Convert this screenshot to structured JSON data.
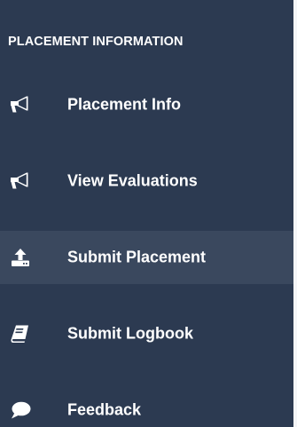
{
  "sidebar": {
    "section_title": "PLACEMENT INFORMATION",
    "items": [
      {
        "label": "Placement Info",
        "icon": "megaphone-icon"
      },
      {
        "label": "View Evaluations",
        "icon": "megaphone-icon"
      },
      {
        "label": "Submit Placement",
        "icon": "upload-icon",
        "active": true
      },
      {
        "label": "Submit Logbook",
        "icon": "book-icon"
      },
      {
        "label": "Feedback",
        "icon": "comment-icon"
      }
    ]
  },
  "colors": {
    "background": "#2c3a51",
    "active_background": "#3a485e",
    "text": "#ffffff"
  }
}
